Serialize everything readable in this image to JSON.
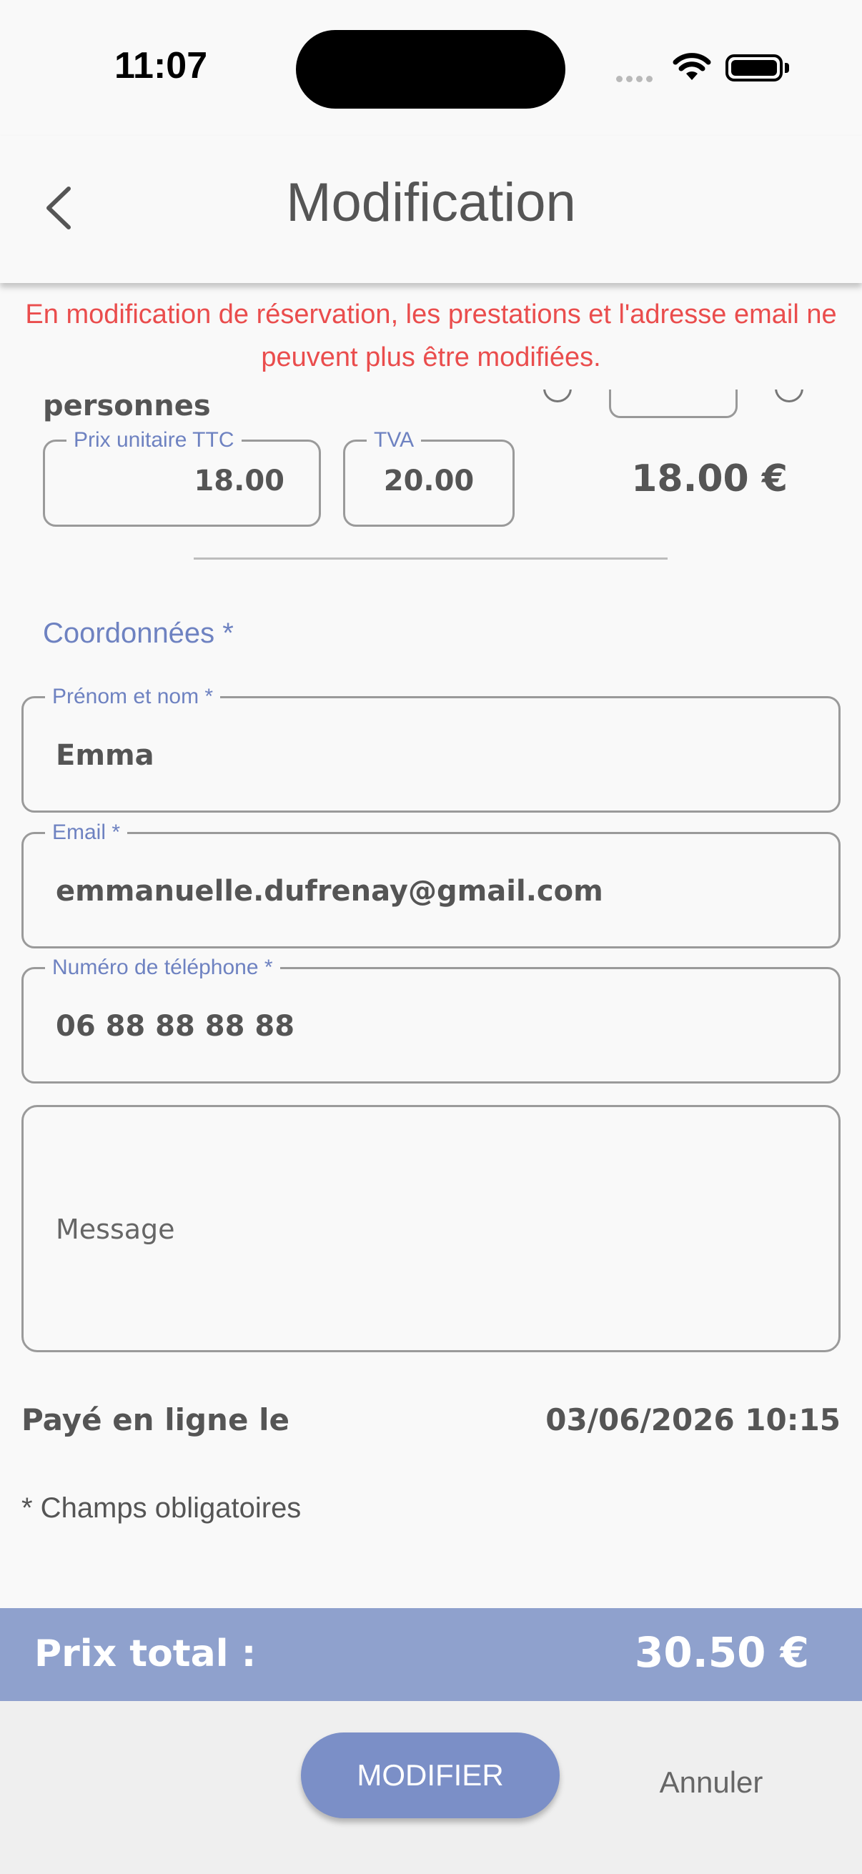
{
  "status_bar": {
    "time": "11:07"
  },
  "header": {
    "title": "Modification"
  },
  "warning": "En modification de réservation, les prestations et l'adresse email ne peuvent plus être modifiées.",
  "service": {
    "label_fragment": "personnes",
    "unit_price_label": "Prix unitaire TTC",
    "unit_price": "18.00",
    "vat_label": "TVA",
    "vat": "20.00",
    "line_total": "18.00 €"
  },
  "contact": {
    "heading": "Coordonnées *",
    "name_label": "Prénom et nom *",
    "name_value": "Emma",
    "email_label": "Email *",
    "email_value": "emmanuelle.dufrenay@gmail.com",
    "phone_label": "Numéro de téléphone *",
    "phone_value": "06 88 88 88 88",
    "message_placeholder": "Message"
  },
  "payment": {
    "label": "Payé en ligne le",
    "value": "03/06/2026 10:15"
  },
  "required_note": "* Champs obligatoires",
  "total": {
    "label": "Prix total :",
    "value": "30.50 €"
  },
  "actions": {
    "modify": "MODIFIER",
    "cancel": "Annuler"
  },
  "colors": {
    "accent": "#7b8fc7",
    "total_bar": "#8fa1cd",
    "warning": "#ea4d4d",
    "label": "#6e82c1"
  },
  "icons": {
    "back": "chevron-left-icon",
    "wifi": "wifi-icon",
    "battery": "battery-icon",
    "signal": "cellular-signal-icon"
  }
}
